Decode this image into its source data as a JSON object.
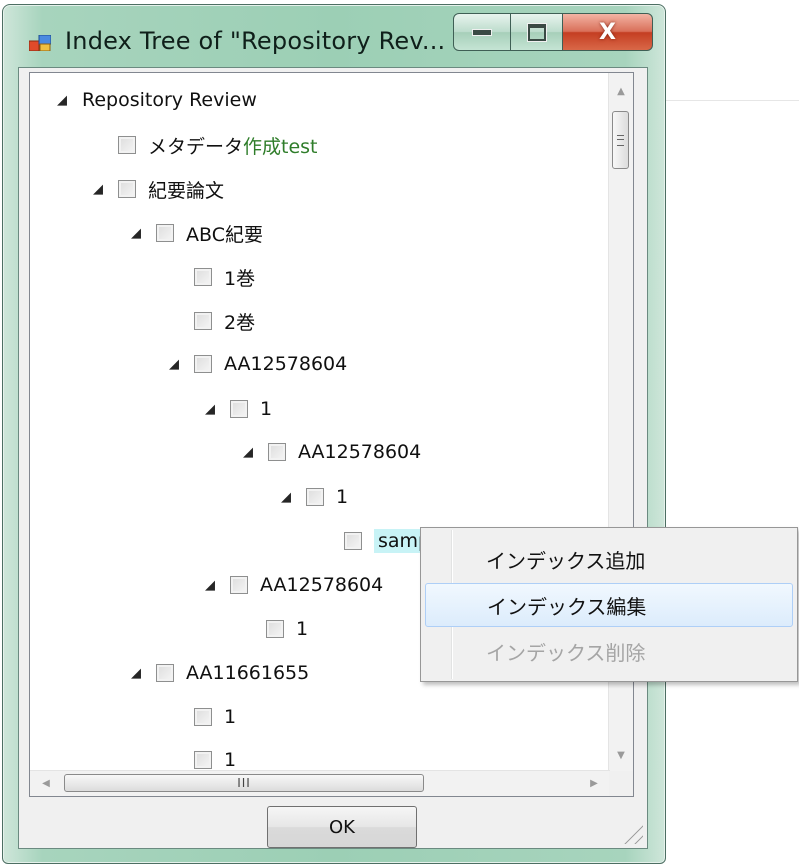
{
  "window": {
    "title": "Index Tree of \"Repository Rev...",
    "close_glyph": "X"
  },
  "tree": {
    "nodes": [
      {
        "label": "Repository Review",
        "expanded": true,
        "checkbox": false
      },
      {
        "label_part1": "メタデータ",
        "label_part2": "作成test",
        "checkbox": true
      },
      {
        "label": "紀要論文",
        "expanded": true,
        "checkbox": true
      },
      {
        "label": "ABC紀要",
        "expanded": true,
        "checkbox": true
      },
      {
        "label": "1巻",
        "checkbox": true
      },
      {
        "label": "2巻",
        "checkbox": true
      },
      {
        "label": "AA12578604",
        "expanded": true,
        "checkbox": true
      },
      {
        "label": "1",
        "expanded": true,
        "checkbox": true
      },
      {
        "label": "AA12578604",
        "expanded": true,
        "checkbox": true
      },
      {
        "label": "1",
        "expanded": true,
        "checkbox": true
      },
      {
        "label": "samp",
        "checkbox": true,
        "selected": true
      },
      {
        "label": "AA12578604",
        "expanded": true,
        "checkbox": true
      },
      {
        "label": "1",
        "checkbox": true
      },
      {
        "label": "AA11661655",
        "expanded": true,
        "checkbox": true
      },
      {
        "label": "1",
        "checkbox": true
      },
      {
        "label": "1",
        "checkbox": true
      }
    ]
  },
  "scrollbar": {
    "h_thumb_glyph": "III"
  },
  "buttons": {
    "ok": "OK"
  },
  "context_menu": {
    "items": [
      {
        "label": "インデックス追加",
        "state": "normal"
      },
      {
        "label": "インデックス編集",
        "state": "hover"
      },
      {
        "label": "インデックス削除",
        "state": "disabled"
      }
    ]
  },
  "colors": {
    "frame": "#9ccfb5",
    "close_button": "#c43e22",
    "selection_highlight": "#c8f3f6",
    "menu_hover": "#dcecfc",
    "green_text": "#2f7d2a"
  }
}
